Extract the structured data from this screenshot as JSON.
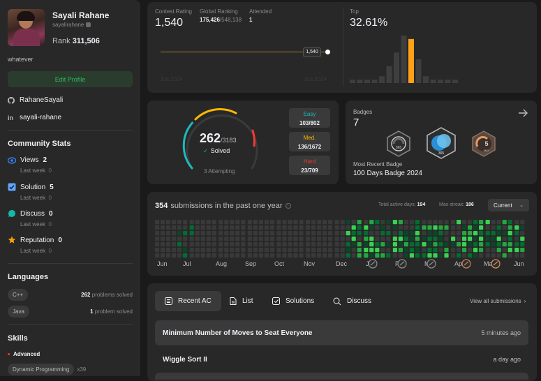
{
  "profile": {
    "name": "Sayali Rahane",
    "username": "sayalirahane",
    "rank_label": "Rank",
    "rank_value": "311,506",
    "bio": "whatever",
    "edit_label": "Edit Profile",
    "github": "RahaneSayali",
    "linkedin": "sayali-rahane"
  },
  "community": {
    "title": "Community Stats",
    "items": [
      {
        "label": "Views",
        "value": "2",
        "sub": "Last week",
        "subval": "0",
        "color": "#3b82f6"
      },
      {
        "label": "Solution",
        "value": "5",
        "sub": "Last week",
        "subval": "0",
        "color": "#60a5fa"
      },
      {
        "label": "Discuss",
        "value": "0",
        "sub": "Last week",
        "subval": "0",
        "color": "#14b8a6"
      },
      {
        "label": "Reputation",
        "value": "0",
        "sub": "Last week",
        "subval": "0",
        "color": "#f59e0b"
      }
    ]
  },
  "languages": {
    "title": "Languages",
    "items": [
      {
        "name": "C++",
        "count": "262",
        "suffix": "problems solved"
      },
      {
        "name": "Java",
        "count": "1",
        "suffix": "problem solved"
      }
    ]
  },
  "skills": {
    "title": "Skills",
    "level": "Advanced",
    "items": [
      {
        "name": "Dynamic Programming",
        "count": "x39"
      }
    ]
  },
  "contest": {
    "rating_label": "Contest Rating",
    "rating": "1,540",
    "global_label": "Global Ranking",
    "global_value": "175,426",
    "global_total": "/548,138",
    "attended_label": "Attended",
    "attended": "1",
    "point_label": "1,540",
    "x_start": "Jun 2024",
    "x_end": "Jun 2024",
    "top_label": "Top",
    "top_value": "32.61%",
    "histogram": [
      1,
      1,
      1,
      1,
      2,
      5,
      9,
      14,
      13,
      7,
      2,
      1,
      1,
      1,
      1
    ],
    "highlight_index": 8,
    "bar_color": "#3e3e3e",
    "highlight_color": "#ffa116"
  },
  "solved": {
    "count": "262",
    "total": "/3183",
    "label": "Solved",
    "attempting": "3 Attempting",
    "easy_label": "Easy",
    "easy": "103/802",
    "easy_color": "#1cbaba",
    "med_label": "Med.",
    "med": "136/1672",
    "med_color": "#ffb700",
    "hard_label": "Hard",
    "hard": "23/709",
    "hard_color": "#f63737"
  },
  "badges": {
    "title": "Badges",
    "count": "7",
    "recent_label": "Most Recent Badge",
    "recent": "100 Days Badge 2024",
    "icons": [
      {
        "name": "badge-365-icon",
        "text": "365"
      },
      {
        "name": "badge-365-blue-icon",
        "text": "365"
      },
      {
        "name": "badge-may-icon",
        "text": "MAY"
      }
    ]
  },
  "calendar": {
    "count": "354",
    "suffix": "submissions in the past one year",
    "active_label": "Total active days:",
    "active": "194",
    "streak_label": "Max streak:",
    "streak": "186",
    "select": "Current",
    "months": [
      "Jun",
      "Jul",
      "Aug",
      "Sep",
      "Oct",
      "Nov",
      "Dec",
      "Jan",
      "Feb",
      "Mar",
      "Apr",
      "May",
      "Jun"
    ],
    "empty_color": "#393939",
    "levels": [
      "#0e4429",
      "#006d32",
      "#26a641",
      "#39d353"
    ]
  },
  "tabs": {
    "recent": "Recent AC",
    "list": "List",
    "solutions": "Solutions",
    "discuss": "Discuss",
    "view_all": "View all submissions"
  },
  "submissions": [
    {
      "title": "Minimum Number of Moves to Seat Everyone",
      "time": "5 minutes ago"
    },
    {
      "title": "Wiggle Sort II",
      "time": "a day ago"
    }
  ]
}
